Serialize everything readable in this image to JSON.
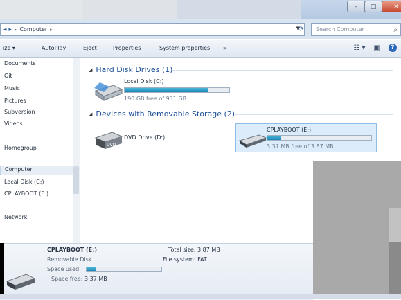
{
  "window": {
    "buttons": {
      "minimize": "–",
      "maximize": "□",
      "close": "✕"
    }
  },
  "address": {
    "crumb": "Computer",
    "search_placeholder": "Search Computer"
  },
  "toolbar": {
    "items": [
      "ize ▾",
      "AutoPlay",
      "Eject",
      "Properties",
      "System properties",
      "»"
    ]
  },
  "nav": {
    "items": [
      "Documents",
      "Git",
      "Music",
      "Pictures",
      "Subversion",
      "Videos",
      "Homegroup",
      "Computer",
      "Local Disk (C:)",
      "CPLAYBOOT (E:)",
      "Network"
    ],
    "selected": "Computer"
  },
  "groups": {
    "hard_disks": {
      "title": "Hard Disk Drives (1)",
      "drives": [
        {
          "name": "Local Disk (C:)",
          "free_text": "190 GB free of 931 GB",
          "used_fraction": 0.8
        }
      ]
    },
    "removable": {
      "title": "Devices with Removable Storage (2)",
      "drives": [
        {
          "name": "DVD Drive (D:)"
        },
        {
          "name": "CPLAYBOOT (E:)",
          "free_text": "3.37 MB free of 3.87 MB",
          "used_fraction": 0.13
        }
      ]
    }
  },
  "details": {
    "name": "CPLAYBOOT (E:)",
    "type": "Removable Disk",
    "space_used_label": "Space used:",
    "space_free_label": "Space free:",
    "space_free_value": "3.37 MB",
    "total_size": "Total size: 3.87 MB",
    "file_system": "File system: FAT"
  },
  "colors": {
    "accent": "#1e86b5",
    "header": "#1b4f97"
  }
}
